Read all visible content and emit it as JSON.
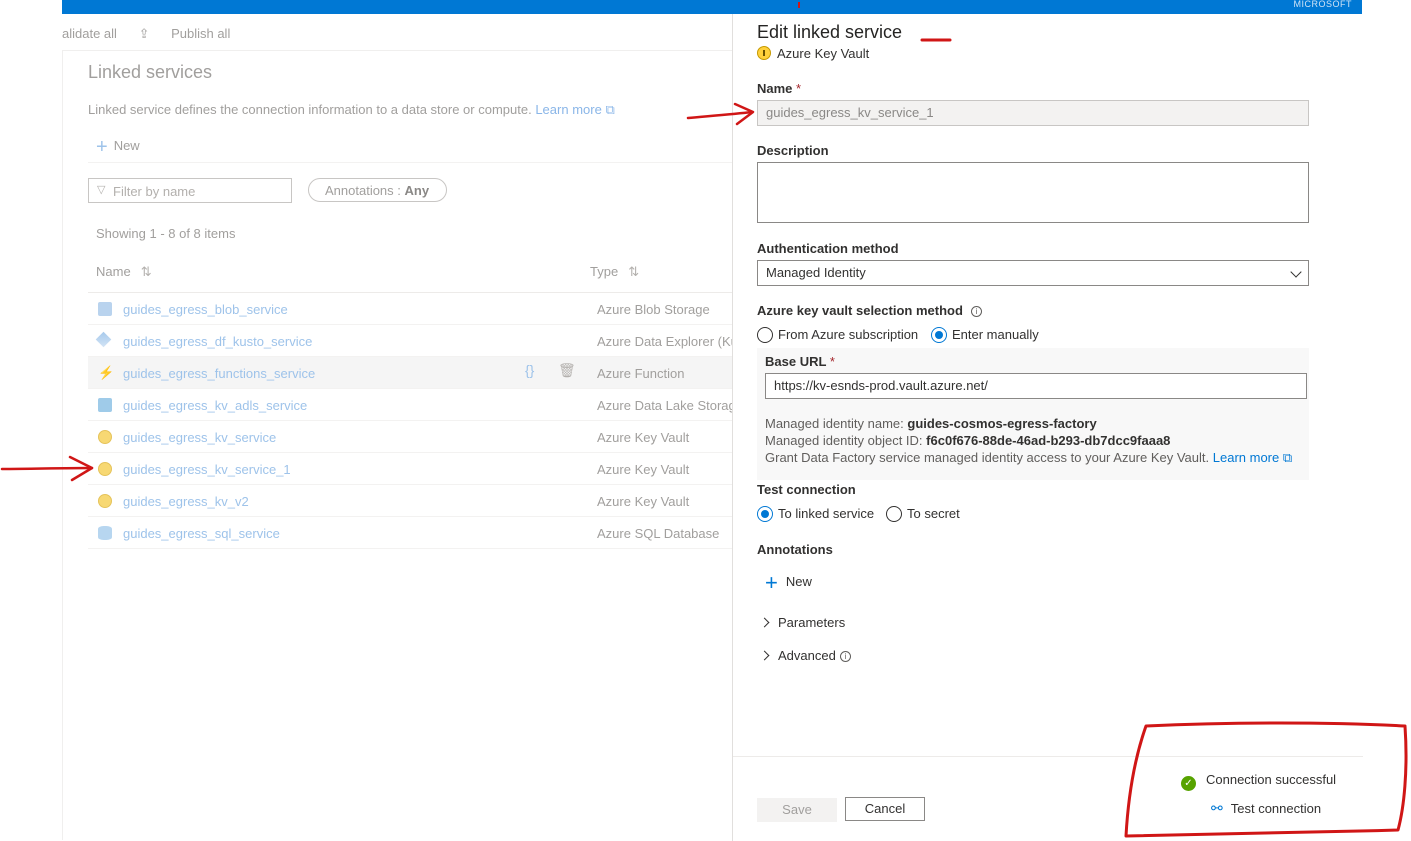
{
  "topbar": {
    "brand_text": "MICROSOFT"
  },
  "toolbar": {
    "validate_label": "alidate all",
    "publish_label": "Publish all"
  },
  "linked_services": {
    "title": "Linked services",
    "description": "Linked service defines the connection information to a data store or compute.",
    "learn_more": "Learn more",
    "new_label": "New",
    "filter_placeholder": "Filter by name",
    "annotations_label": "Annotations :",
    "annotations_value": "Any",
    "showing": "Showing 1 - 8 of 8 items",
    "columns": {
      "name": "Name",
      "type": "Type"
    },
    "rows": [
      {
        "name": "guides_egress_blob_service",
        "type": "Azure Blob Storage",
        "icon": "blob-icon"
      },
      {
        "name": "guides_egress_df_kusto_service",
        "type": "Azure Data Explorer (Ku",
        "icon": "kusto-icon"
      },
      {
        "name": "guides_egress_functions_service",
        "type": "Azure Function",
        "icon": "function-icon",
        "actions": {
          "code": "{}",
          "delete": "🗑"
        }
      },
      {
        "name": "guides_egress_kv_adls_service",
        "type": "Azure Data Lake Storage",
        "icon": "adls-icon"
      },
      {
        "name": "guides_egress_kv_service",
        "type": "Azure Key Vault",
        "icon": "key-vault-icon"
      },
      {
        "name": "guides_egress_kv_service_1",
        "type": "Azure Key Vault",
        "icon": "key-vault-icon"
      },
      {
        "name": "guides_egress_kv_v2",
        "type": "Azure Key Vault",
        "icon": "key-vault-icon"
      },
      {
        "name": "guides_egress_sql_service",
        "type": "Azure SQL Database",
        "icon": "sql-database-icon"
      }
    ]
  },
  "edit_pane": {
    "title": "Edit linked service",
    "subtitle": "Azure Key Vault",
    "name_label": "Name",
    "required_mark": "*",
    "name_value": "guides_egress_kv_service_1",
    "description_label": "Description",
    "description_value": "",
    "auth_label": "Authentication method",
    "auth_value": "Managed Identity",
    "kv_selection_label": "Azure key vault selection method",
    "kv_option_subscription": "From Azure subscription",
    "kv_option_manual": "Enter manually",
    "kv_selected": "Enter manually",
    "base_url_label": "Base URL",
    "base_url_value": "https://kv-esnds-prod.vault.azure.net/",
    "mi_name_label": "Managed identity name:",
    "mi_name_value": "guides-cosmos-egress-factory",
    "mi_object_label": "Managed identity object ID:",
    "mi_object_value": "f6c0f676-88de-46ad-b293-db7dcc9faaa8",
    "mi_grant_text": "Grant Data Factory service managed identity access to your Azure Key Vault.",
    "mi_learn_more": "Learn more",
    "test_conn_label": "Test connection",
    "test_option_linked": "To linked service",
    "test_option_secret": "To secret",
    "test_selected": "To linked service",
    "annotations_label": "Annotations",
    "annotations_new": "New",
    "parameters_label": "Parameters",
    "advanced_label": "Advanced",
    "save_label": "Save",
    "cancel_label": "Cancel",
    "connection_status": "Connection successful",
    "test_connection_button": "Test connection"
  },
  "colors": {
    "accent": "#0078d4",
    "success": "#57a300",
    "annotation_red": "#d01616"
  }
}
